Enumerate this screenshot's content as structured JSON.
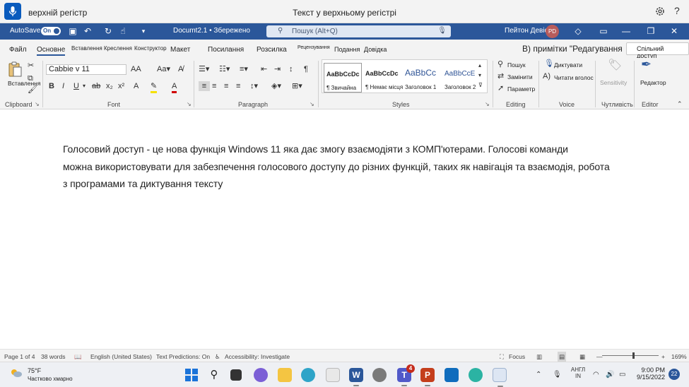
{
  "voice_access": {
    "status": "верхній регістр",
    "header": "Текст у верхньому регістрі"
  },
  "titlebar": {
    "autosave_label": "AutoSave",
    "autosave_state": "On",
    "doc_title": "Documt2.1 • Збережено",
    "search_placeholder": "Пошук (Alt+Q)",
    "user_name": "Пейтон Девіс",
    "user_initials": "PD"
  },
  "tabs": {
    "file": "Файл",
    "home": "Основне",
    "insert": "Вставлення",
    "draw": "Креслення",
    "design": "Конструктор",
    "layout": "Макет",
    "references": "Посилання",
    "mailings": "Розсилка",
    "review": "Рецензування",
    "view": "Подання",
    "help": "Довідка",
    "comments_overlay": "B) примітки \"Редагування",
    "share": "Спільний доступ"
  },
  "ribbon": {
    "clipboard": {
      "paste": "Вставлення",
      "label": "Clipboard"
    },
    "font": {
      "name": "Cabbie v 11",
      "label": "Font"
    },
    "paragraph": {
      "label": "Paragraph"
    },
    "styles": {
      "label": "Styles",
      "items": [
        {
          "sample": "AaBbCcDc",
          "name": "¶ Звичайна"
        },
        {
          "sample": "AaBbCcDc",
          "name": "¶ Немає місця"
        },
        {
          "sample": "AaBbCc",
          "name": "Заголовок 1"
        },
        {
          "sample": "AaBbCcE",
          "name": "Заголовок 2"
        }
      ]
    },
    "editing": {
      "find": "Пошук",
      "replace": "Замінити",
      "select": "Параметр",
      "label": "Editing"
    },
    "voice": {
      "dictate": "Диктувати",
      "read_aloud": "Читати вголос",
      "label": "Voice"
    },
    "sensitivity": {
      "button": "Sensitivity",
      "label": "Чутливість"
    },
    "editor": {
      "button": "Редактор",
      "label": "Editor"
    }
  },
  "document": {
    "lines": [
      "Голосовий доступ - це нова функція Windows 11 яка дає змогу взаємодіяти з КОМП'ютерами. Голосові команди",
      "можна використовувати для забезпечення голосового доступу до різних функцій, таких як навігація та взаємодія, робота",
      "з програмами та диктування тексту"
    ]
  },
  "statusbar": {
    "page": "Page 1 of 4",
    "words": "38 words",
    "language": "English (United States)",
    "text_predictions": "Text Predictions: On",
    "accessibility": "Accessibility: Investigate",
    "focus": "Focus",
    "zoom": "169%",
    "zoom_level": 0.55
  },
  "taskbar": {
    "temp": "75°F",
    "weather": "Частково хмарно",
    "teams_badge": "4",
    "language_top": "АНГЛ",
    "language_bottom": "IN",
    "time": "9:00 PM",
    "date": "9/15/2022",
    "notifications": "22"
  },
  "colors": {
    "title_bar": "#2b579a",
    "voice_mic": "#0a5bbd",
    "ribbon_bg": "#f3f3f3"
  }
}
